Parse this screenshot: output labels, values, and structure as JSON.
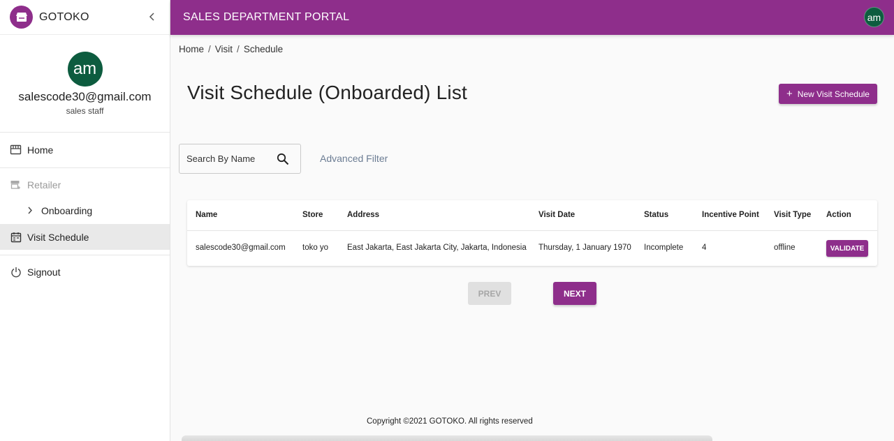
{
  "colors": {
    "brand": "#8e2e8b",
    "avatar": "#0d5c3f",
    "filter_link": "#6b7c93"
  },
  "brand": {
    "name": "GOTOKO",
    "logo_icon": "store-icon"
  },
  "header": {
    "title": "SALES DEPARTMENT PORTAL",
    "avatar_initials": "am"
  },
  "profile": {
    "initials": "am",
    "email": "salescode30@gmail.com",
    "role": "sales staff"
  },
  "sidebar": {
    "items": [
      {
        "label": "Home",
        "icon": "storefront-icon"
      },
      {
        "label": "Retailer",
        "icon": "store-add-icon",
        "disabled": true
      },
      {
        "label": "Onboarding",
        "icon": "chevron-right-icon",
        "sub": true
      },
      {
        "label": "Visit Schedule",
        "icon": "calendar-icon",
        "active": true
      },
      {
        "label": "Signout",
        "icon": "power-icon"
      }
    ]
  },
  "breadcrumb": [
    "Home",
    "Visit",
    "Schedule"
  ],
  "page": {
    "title": "Visit Schedule (Onboarded) List",
    "new_button": "New Visit Schedule",
    "search_placeholder": "Search By Name",
    "advanced_filter": "Advanced Filter"
  },
  "table": {
    "columns": [
      "Name",
      "Store",
      "Address",
      "Visit Date",
      "Status",
      "Incentive Point",
      "Visit Type",
      "Action"
    ],
    "rows": [
      {
        "name": "salescode30@gmail.com",
        "store": "toko yo",
        "address": "East Jakarta, East Jakarta City, Jakarta, Indonesia",
        "visit_date": "Thursday, 1 January 1970",
        "status": "Incomplete",
        "incentive_point": "4",
        "visit_type": "offline",
        "action": "VALIDATE"
      }
    ]
  },
  "pagination": {
    "prev": "PREV",
    "next": "NEXT"
  },
  "footer": {
    "text": "Copyright ©2021 GOTOKO. All rights reserved"
  }
}
